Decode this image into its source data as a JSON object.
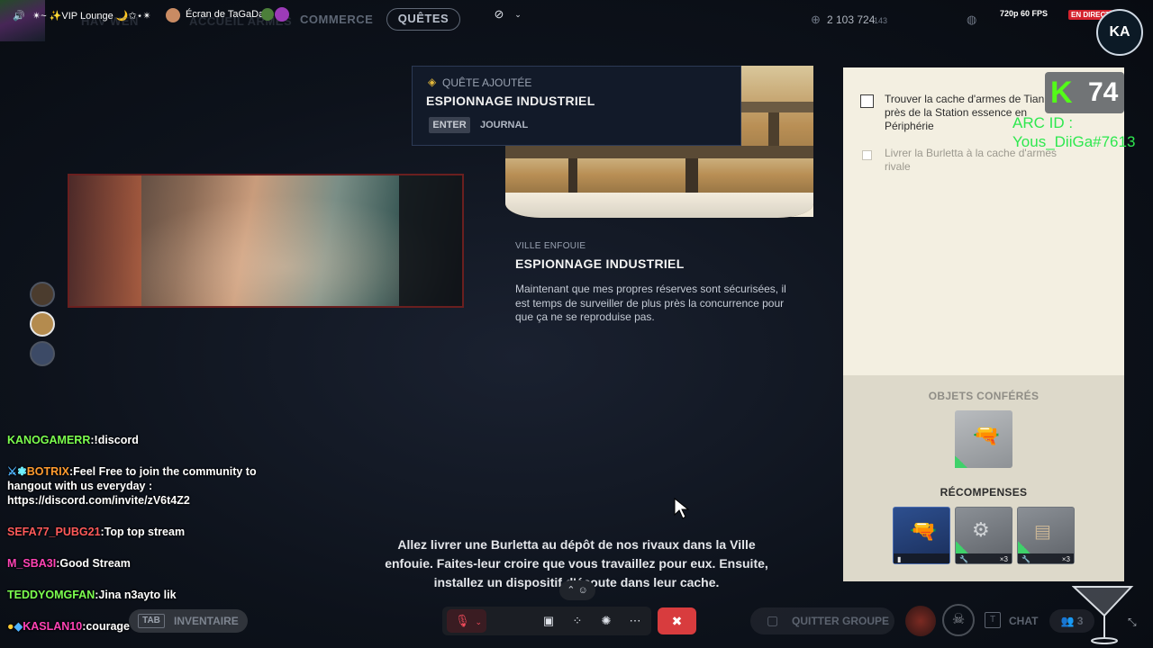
{
  "topbar": {
    "channel_name": "✴︎~ ✨VIP Lounge 🌙✩⋆✴︎",
    "screen_share": "Écran de TaGaDa",
    "hidden_tab_1": "HAV WEN",
    "hidden_tab_2": "ACCUEIL ARMES",
    "commerce": "COMMERCE",
    "quetes": "QUÊTES",
    "coins": "2 103 724",
    "coins_extra": "143",
    "stream_quality": "720p 60 FPS",
    "live": "EN DIRECT"
  },
  "toast": {
    "tag": "QUÊTE AJOUTÉE",
    "title": "ESPIONNAGE INDUSTRIEL",
    "key": "ENTER",
    "action": "JOURNAL"
  },
  "quest": {
    "region": "VILLE ENFOUIE",
    "title": "ESPIONNAGE INDUSTRIEL",
    "description": "Maintenant que mes propres réserves sont sécurisées, il est temps de surveiller de plus près la concurrence pour que ça ne se reproduise pas."
  },
  "objectives": [
    {
      "text_line1": "Trouver la cache d'armes de Tian",
      "text_line2": "près de la Station essence en",
      "text_line3": "Périphérie",
      "done": false
    },
    {
      "text_line1": "Livrer la Burletta à la cache d'armes",
      "text_line2": "rivale",
      "done": false
    }
  ],
  "rewards": {
    "granted_heading": "OBJETS CONFÉRÉS",
    "rewards_heading": "RÉCOMPENSES",
    "tile_count_2": "×3",
    "tile_count_3": "×3"
  },
  "overlay": {
    "kick_logo": "K",
    "viewer_count": "74",
    "arc_id_label": "ARC ID :",
    "arc_id_value": "Yous_DiiGa#7613"
  },
  "chat": [
    {
      "user": "KANOGAMERR",
      "sep": ":",
      "msg": "!discord"
    },
    {
      "user": "BOTRIX",
      "sep": ":",
      "msg": "Feel Free to join the community to hangout with us everyday : https://discord.com/invite/zV6t4Z2"
    },
    {
      "user": "SEFA77_PUBG21",
      "sep": ":",
      "msg": "Top top stream"
    },
    {
      "user": "M_SBA3I",
      "sep": ":",
      "msg": "Good Stream"
    },
    {
      "user": "TEDDYOMGFAN",
      "sep": ":",
      "msg": "Jina n3ayto lik"
    },
    {
      "user": "KASLAN10",
      "sep": ":",
      "msg": "courage"
    }
  ],
  "subtitle": {
    "line1": "Allez livrer une Burletta au dépôt de nos rivaux dans la Ville",
    "line2": "enfouie. Faites-leur croire que vous travaillez pour eux. Ensuite,",
    "line3": "installez un dispositif d'écoute dans leur cache."
  },
  "bottombar": {
    "tab_key": "TAB",
    "inventory": "INVENTAIRE",
    "quit_group": "QUITTER GROUPE",
    "chat": "CHAT",
    "party_count": "3"
  },
  "logo_text": "KA",
  "colors": {
    "kick_green": "#53fc18",
    "arc_id_green": "#2ee84f",
    "live_red": "#d4212c",
    "end_call_red": "#d83c3e",
    "panel_cream": "#f3efe1",
    "panel_tan": "#ddd9ca"
  }
}
